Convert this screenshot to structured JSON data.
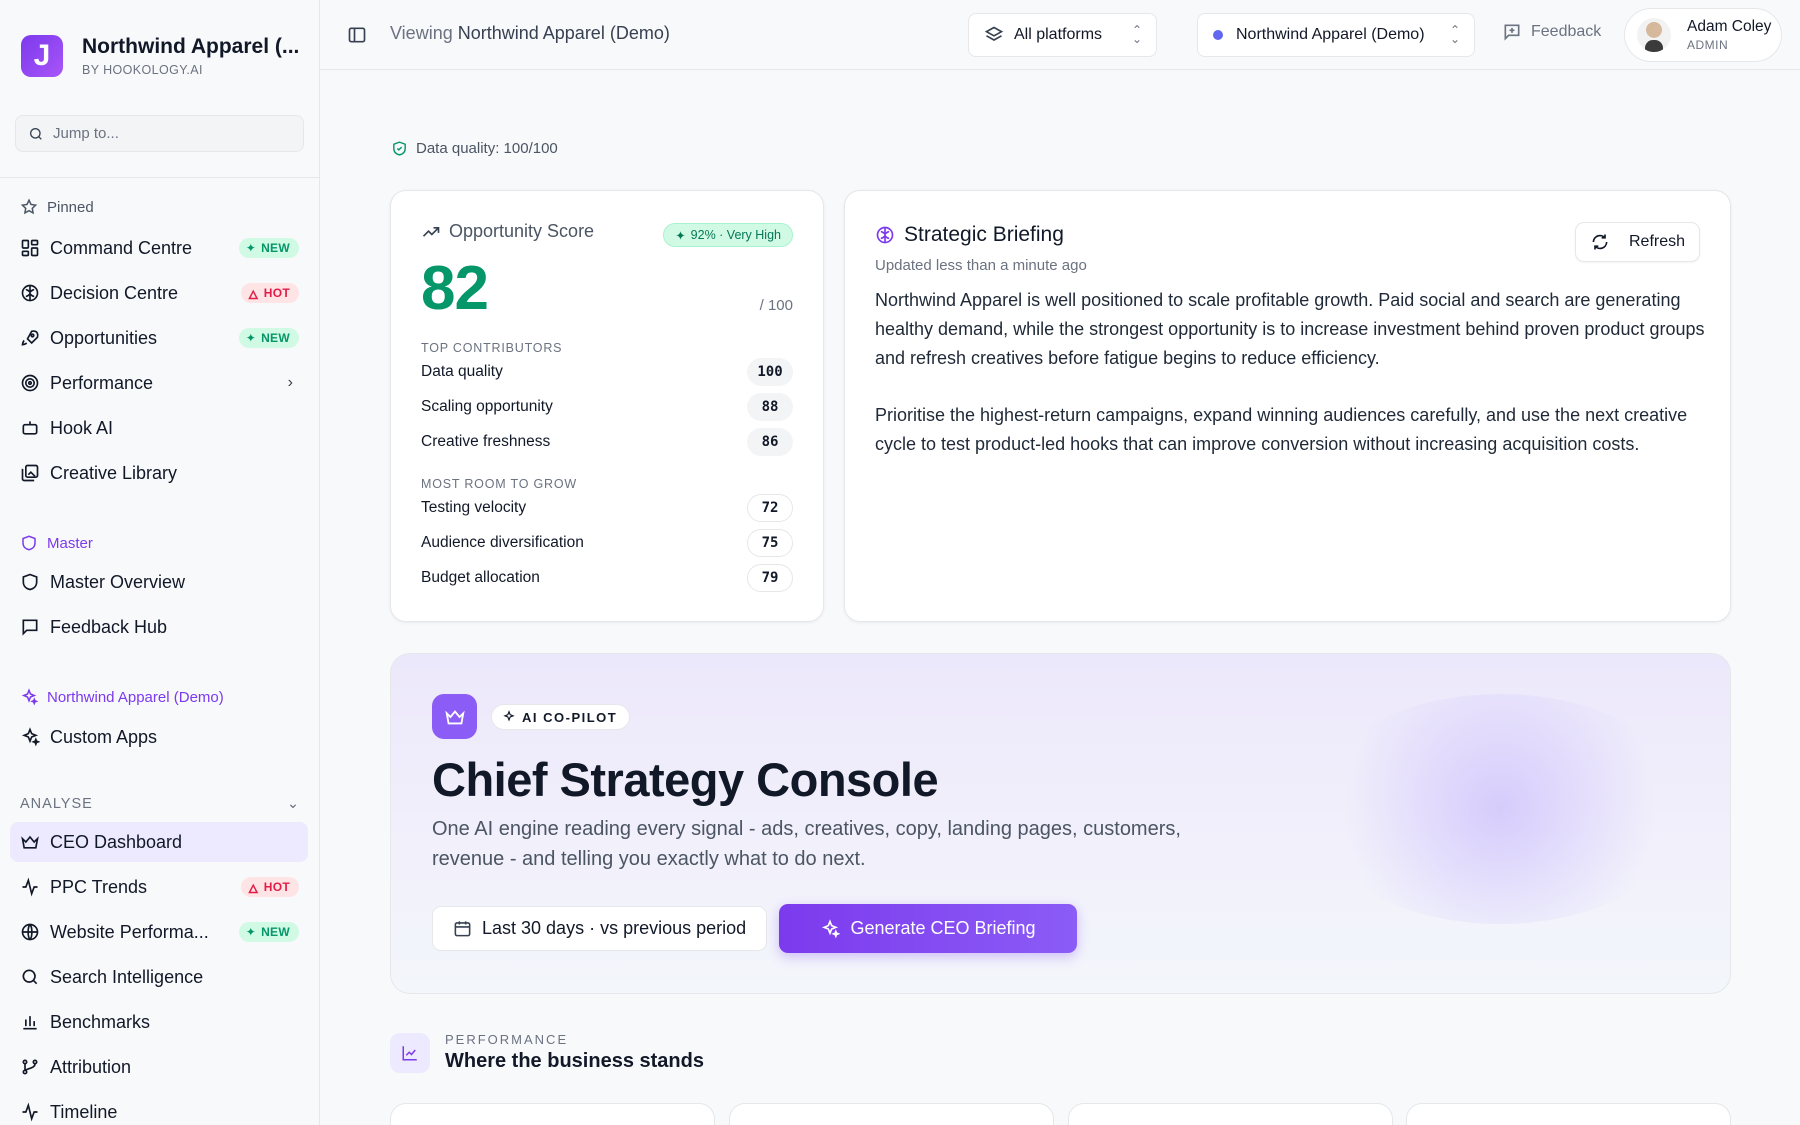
{
  "brand": {
    "logo_letter": "J",
    "name": "Northwind Apparel (...",
    "sub": "BY HOOKOLOGY.AI"
  },
  "search": {
    "placeholder": "Jump to..."
  },
  "sidebar": {
    "pinned_label": "Pinned",
    "pinned": [
      {
        "label": "Command Centre",
        "icon": "grid-icon",
        "badge": "NEW"
      },
      {
        "label": "Decision Centre",
        "icon": "brain-icon",
        "badge": "HOT"
      },
      {
        "label": "Opportunities",
        "icon": "rocket-icon",
        "badge": "NEW"
      },
      {
        "label": "Performance",
        "icon": "target-icon",
        "chevron": "›"
      },
      {
        "label": "Hook AI",
        "icon": "bot-icon"
      },
      {
        "label": "Creative Library",
        "icon": "gallery-icon"
      }
    ],
    "master_label": "Master",
    "master": [
      {
        "label": "Master Overview",
        "icon": "shield-icon"
      },
      {
        "label": "Feedback Hub",
        "icon": "chat-icon"
      }
    ],
    "client_label": "Northwind Apparel (Demo)",
    "client": [
      {
        "label": "Custom Apps",
        "icon": "sparkles-icon"
      }
    ],
    "analyse_label": "ANALYSE",
    "analyse_chevron": "⌄",
    "analyse": [
      {
        "label": "CEO Dashboard",
        "icon": "crown-icon",
        "active": true
      },
      {
        "label": "PPC Trends",
        "icon": "activity-icon",
        "badge": "HOT"
      },
      {
        "label": "Website Performa...",
        "icon": "globe-icon",
        "badge": "NEW"
      },
      {
        "label": "Search Intelligence",
        "icon": "search-icon"
      },
      {
        "label": "Benchmarks",
        "icon": "bar-chart-icon"
      },
      {
        "label": "Attribution",
        "icon": "branch-icon"
      },
      {
        "label": "Timeline",
        "icon": "pulse-icon"
      }
    ]
  },
  "topbar": {
    "viewing_prefix": "Viewing",
    "viewing_name": "Northwind Apparel (Demo)",
    "platform_select": "All platforms",
    "account_select": "Northwind Apparel (Demo)",
    "feedback": "Feedback",
    "user_name": "Adam Coley",
    "user_role": "ADMIN"
  },
  "data_quality": "Data quality: 100/100",
  "opportunity": {
    "title": "Opportunity Score",
    "confidence": "92% · Very High",
    "score": "82",
    "out_of": "/ 100",
    "top_label": "TOP CONTRIBUTORS",
    "top": [
      {
        "label": "Data quality",
        "value": "100"
      },
      {
        "label": "Scaling opportunity",
        "value": "88"
      },
      {
        "label": "Creative freshness",
        "value": "86"
      }
    ],
    "grow_label": "MOST ROOM TO GROW",
    "grow": [
      {
        "label": "Testing velocity",
        "value": "72"
      },
      {
        "label": "Audience diversification",
        "value": "75"
      },
      {
        "label": "Budget allocation",
        "value": "79"
      }
    ]
  },
  "briefing": {
    "title": "Strategic Briefing",
    "updated": "Updated less than a minute ago",
    "refresh": "Refresh",
    "p1": "Northwind Apparel is well positioned to scale profitable growth. Paid social and search are generating healthy demand, while the strongest opportunity is to increase investment behind proven product groups and refresh creatives before fatigue begins to reduce efficiency.",
    "p2": "Prioritise the highest-return campaigns, expand winning audiences carefully, and use the next creative cycle to test product-led hooks that can improve conversion without increasing acquisition costs."
  },
  "console": {
    "tag": "AI CO-PILOT",
    "title": "Chief Strategy Console",
    "desc": "One AI engine reading every signal - ads, creatives, copy, landing pages, customers, revenue - and telling you exactly what to do next.",
    "range": "Last 30 days · vs previous period",
    "generate": "Generate CEO Briefing"
  },
  "performance": {
    "kicker": "PERFORMANCE",
    "title": "Where the business stands"
  },
  "colors": {
    "accent": "#7c3aed",
    "score": "#059669",
    "new_badge": "#059669",
    "hot_badge": "#e11d48"
  }
}
